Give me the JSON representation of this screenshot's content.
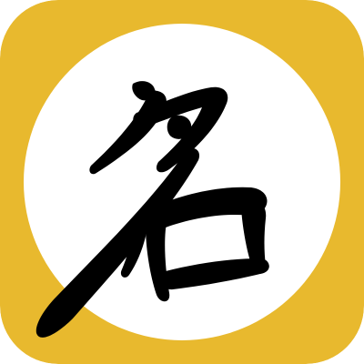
{
  "icon": {
    "name": "app-icon",
    "glyph": "名",
    "glyph_style": "calligraphy-brush",
    "colors": {
      "background": "#E8B92E",
      "circle": "#FFFFFF",
      "ink": "#000000"
    }
  }
}
